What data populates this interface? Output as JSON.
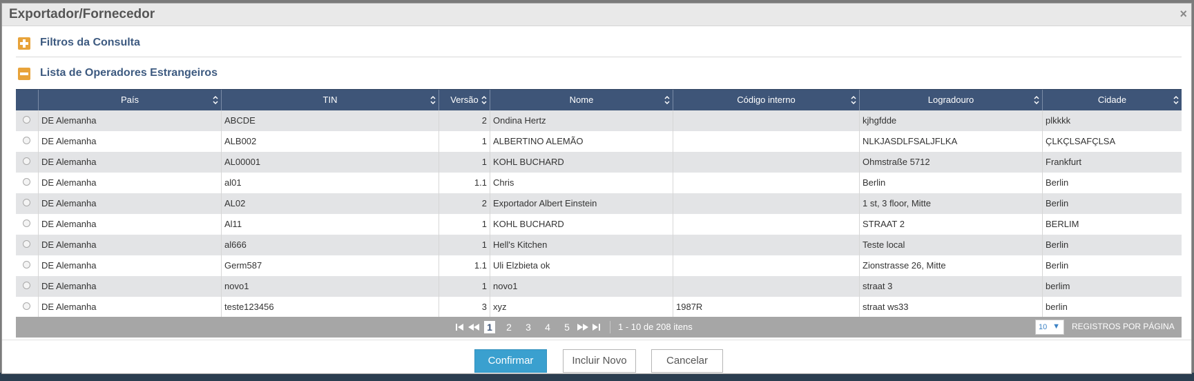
{
  "dialog": {
    "title": "Exportador/Fornecedor",
    "close_label": "×"
  },
  "filters": {
    "label": "Filtros da Consulta",
    "icon": "plus-square-icon",
    "expanded": false
  },
  "list": {
    "label": "Lista de Operadores Estrangeiros",
    "icon": "minus-square-icon",
    "expanded": true
  },
  "grid": {
    "columns": [
      {
        "key": "pais",
        "label": "País"
      },
      {
        "key": "tin",
        "label": "TIN"
      },
      {
        "key": "versao",
        "label": "Versão"
      },
      {
        "key": "nome",
        "label": "Nome"
      },
      {
        "key": "codigo",
        "label": "Código interno"
      },
      {
        "key": "logradouro",
        "label": "Logradouro"
      },
      {
        "key": "cidade",
        "label": "Cidade"
      }
    ],
    "rows": [
      {
        "pais": "DE Alemanha",
        "tin": "ABCDE",
        "versao": "2",
        "nome": "Ondina Hertz",
        "codigo": "",
        "logradouro": "kjhgfdde",
        "cidade": "plkkkk"
      },
      {
        "pais": "DE Alemanha",
        "tin": "ALB002",
        "versao": "1",
        "nome": "ALBERTINO ALEMÃO",
        "codigo": "",
        "logradouro": "NLKJASDLFSALJFLKA",
        "cidade": "ÇLKÇLSAFÇLSA"
      },
      {
        "pais": "DE Alemanha",
        "tin": "AL00001",
        "versao": "1",
        "nome": "KOHL BUCHARD",
        "codigo": "",
        "logradouro": "Ohmstraße 5712",
        "cidade": "Frankfurt"
      },
      {
        "pais": "DE Alemanha",
        "tin": "al01",
        "versao": "1.1",
        "nome": "Chris",
        "codigo": "",
        "logradouro": "Berlin",
        "cidade": "Berlin"
      },
      {
        "pais": "DE Alemanha",
        "tin": "AL02",
        "versao": "2",
        "nome": "Exportador Albert Einstein",
        "codigo": "",
        "logradouro": "1 st, 3 floor, Mitte",
        "cidade": "Berlin"
      },
      {
        "pais": "DE Alemanha",
        "tin": "Al11",
        "versao": "1",
        "nome": "KOHL BUCHARD",
        "codigo": "",
        "logradouro": "STRAAT 2",
        "cidade": "BERLIM"
      },
      {
        "pais": "DE Alemanha",
        "tin": "al666",
        "versao": "1",
        "nome": "Hell's Kitchen",
        "codigo": "",
        "logradouro": "Teste local",
        "cidade": "Berlin"
      },
      {
        "pais": "DE Alemanha",
        "tin": "Germ587",
        "versao": "1.1",
        "nome": "Uli Elzbieta ok",
        "codigo": "",
        "logradouro": "Zionstrasse 26, Mitte",
        "cidade": "Berlin"
      },
      {
        "pais": "DE Alemanha",
        "tin": "novo1",
        "versao": "1",
        "nome": "novo1",
        "codigo": "",
        "logradouro": "straat 3",
        "cidade": "berlim"
      },
      {
        "pais": "DE Alemanha",
        "tin": "teste123456",
        "versao": "3",
        "nome": "xyz",
        "codigo": "1987R",
        "logradouro": "straat ws33",
        "cidade": "berlin"
      }
    ]
  },
  "pager": {
    "pages": [
      "1",
      "2",
      "3",
      "4",
      "5"
    ],
    "current_page": "1",
    "info": "1 - 10 de 208 itens",
    "page_size": "10",
    "page_size_arrow": "▼",
    "page_size_label": "REGISTROS POR PÁGINA",
    "icons": [
      "first-page-icon",
      "previous-page-icon",
      "next-page-icon",
      "last-page-icon"
    ]
  },
  "buttons": {
    "confirm": "Confirmar",
    "new": "Incluir Novo",
    "cancel": "Cancelar"
  },
  "colors": {
    "header_bg": "#3e5578",
    "accent_orange": "#e8a33a",
    "section_title": "#3d5a80",
    "primary_button": "#3aa0cf",
    "pager_bg": "#a6a6a6",
    "row_alt": "#e3e4e6"
  }
}
